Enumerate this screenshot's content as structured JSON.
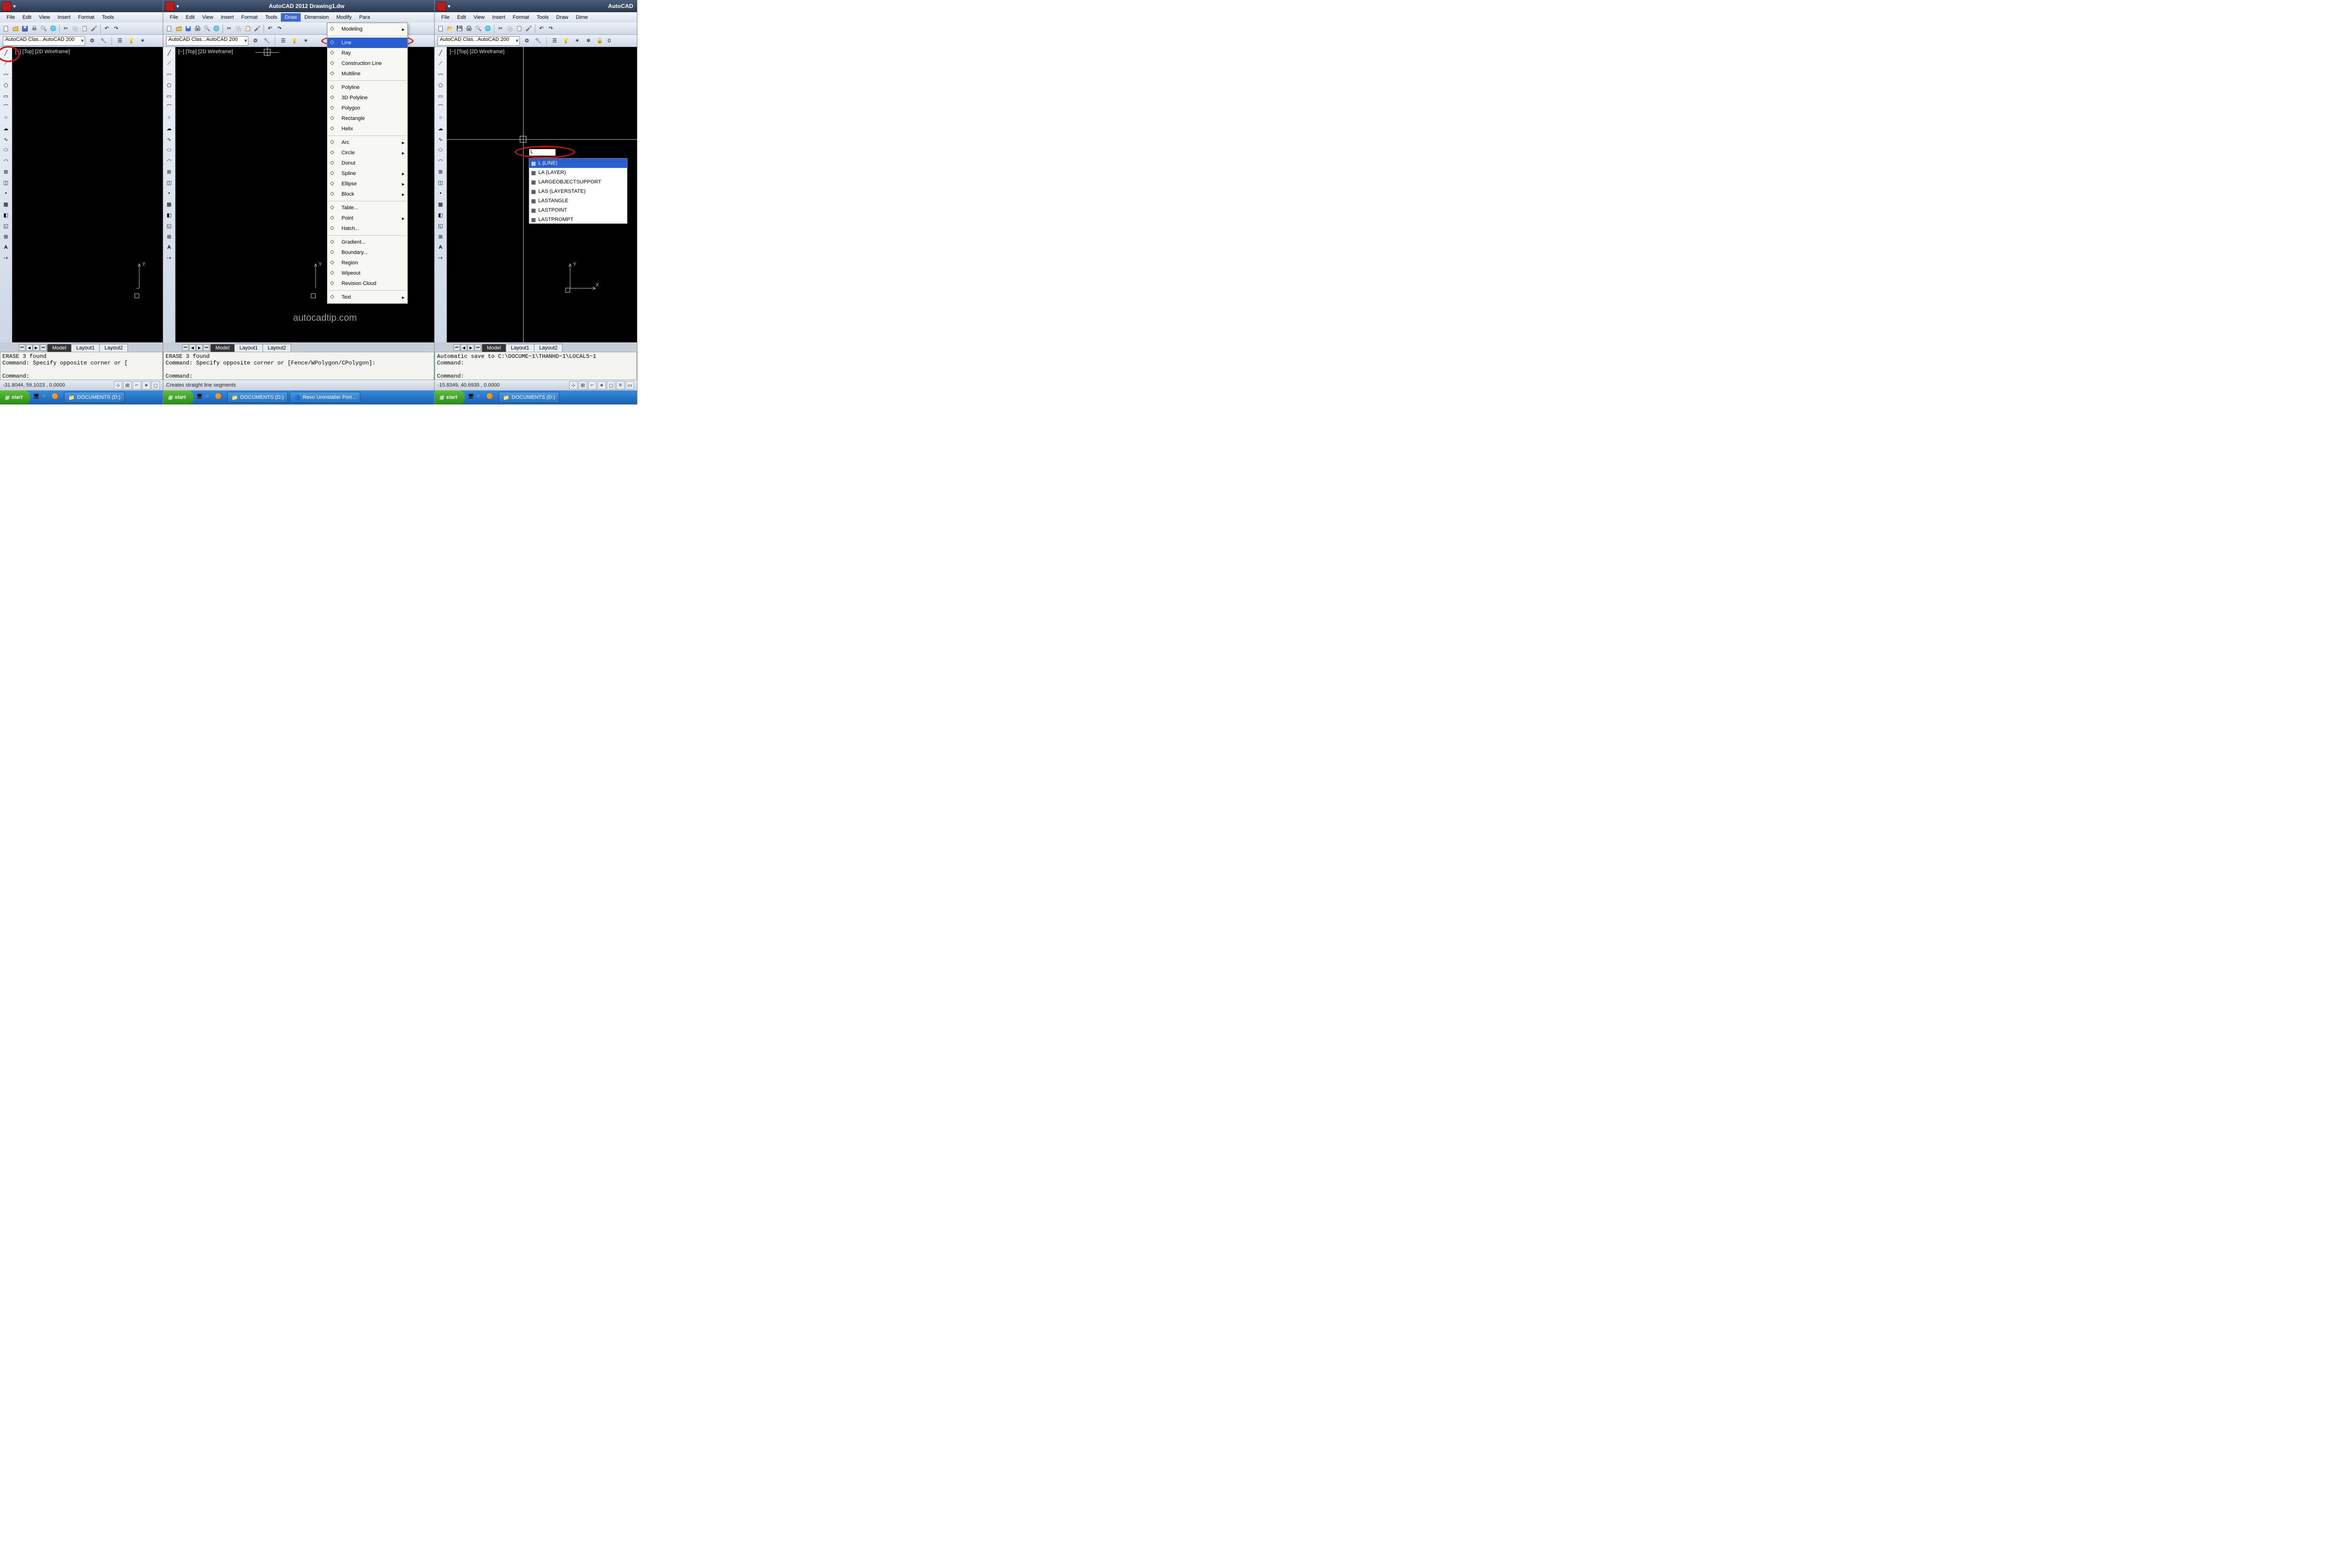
{
  "app": {
    "title_middle": "AutoCAD 2012   Drawing1.dw",
    "title_right": "AutoCAD"
  },
  "menus": [
    "File",
    "Edit",
    "View",
    "Insert",
    "Format",
    "Tools",
    "Draw",
    "Dimension",
    "Modify",
    "Para"
  ],
  "menus_r": [
    "File",
    "Edit",
    "View",
    "Insert",
    "Format",
    "Tools",
    "Draw",
    "Dime"
  ],
  "workspace": {
    "label": "AutoCAD Clas...AutoCAD 200",
    "layer": "0"
  },
  "view_label": "[−] [Top] [2D Wireframe]",
  "layout_tabs": [
    "Model",
    "Layout1",
    "Layout2"
  ],
  "draw_menu": {
    "groups": [
      [
        {
          "label": "Modeling",
          "sub": true
        }
      ],
      [
        {
          "label": "Line",
          "hl": true
        },
        {
          "label": "Ray"
        },
        {
          "label": "Construction Line"
        },
        {
          "label": "Multiline"
        }
      ],
      [
        {
          "label": "Polyline"
        },
        {
          "label": "3D Polyline"
        },
        {
          "label": "Polygon"
        },
        {
          "label": "Rectangle"
        },
        {
          "label": "Helix"
        }
      ],
      [
        {
          "label": "Arc",
          "sub": true
        },
        {
          "label": "Circle",
          "sub": true
        },
        {
          "label": "Donut"
        },
        {
          "label": "Spline",
          "sub": true
        },
        {
          "label": "Ellipse",
          "sub": true
        },
        {
          "label": "Block",
          "sub": true
        }
      ],
      [
        {
          "label": "Table..."
        },
        {
          "label": "Point",
          "sub": true
        },
        {
          "label": "Hatch..."
        }
      ],
      [
        {
          "label": "Gradient..."
        },
        {
          "label": "Boundary..."
        },
        {
          "label": "Region"
        },
        {
          "label": "Wipeout"
        },
        {
          "label": "Revision Cloud"
        }
      ],
      [
        {
          "label": "Text",
          "sub": true
        }
      ]
    ]
  },
  "cmd": {
    "p12": "ERASE 3 found\nCommand: Specify opposite corner or [\n\nCommand:",
    "p2": "ERASE 3 found\nCommand: Specify opposite corner or [Fence/WPolygon/CPolygon]:\n\nCommand:",
    "p3": "Automatic save to C:\\DOCUME~1\\THANHD~1\\LOCALS~1\nCommand:\n\nCommand:"
  },
  "status": {
    "coords1": "-31.8044, 59.1023 , 0.0000",
    "coords2": "Creates straight line segments",
    "coords3": "-15.8349, 40.6935 , 0.0000"
  },
  "autocomplete": {
    "input": "L",
    "items": [
      "L (LINE)",
      "LA (LAYER)",
      "LARGEOBJECTSUPPORT",
      "LAS (LAYERSTATE)",
      "LASTANGLE",
      "LASTPOINT",
      "LASTPROMPT"
    ]
  },
  "taskbar": {
    "start": "start",
    "items1": [
      "DOCUMENTS (D:)"
    ],
    "items2": [
      "DOCUMENTS (D:)",
      "Revo Uninstaller Port..."
    ],
    "items3": [
      "DOCUMENTS (D:)"
    ]
  },
  "watermark": "autocadtip.com"
}
